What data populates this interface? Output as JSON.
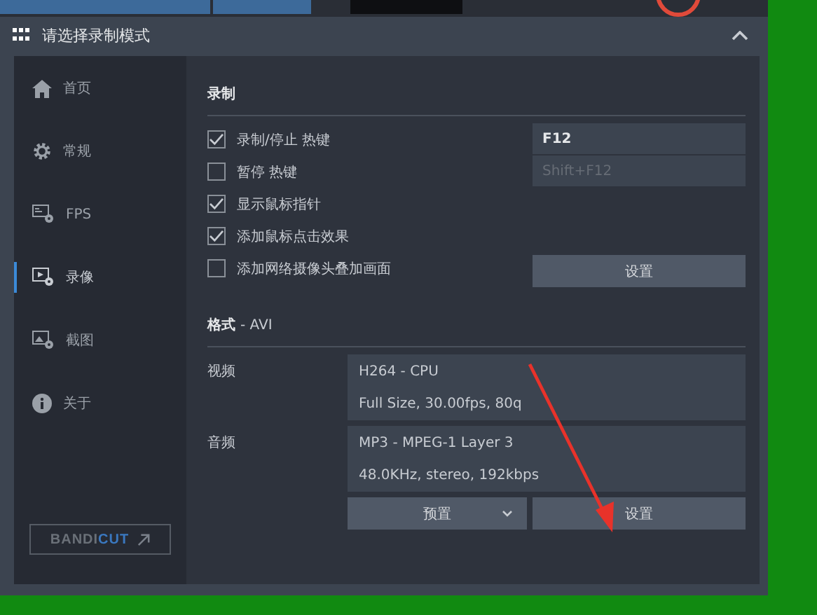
{
  "window": {
    "title": "请选择录制模式"
  },
  "sidebar": {
    "items": [
      {
        "label": "首页",
        "kind": "home",
        "selected": false
      },
      {
        "label": "常规",
        "kind": "gear",
        "selected": false
      },
      {
        "label": "FPS",
        "kind": "fps",
        "selected": false
      },
      {
        "label": "录像",
        "kind": "video",
        "selected": true
      },
      {
        "label": "截图",
        "kind": "image",
        "selected": false
      },
      {
        "label": "关于",
        "kind": "info",
        "selected": false
      }
    ],
    "logo_parts": [
      "BANDI",
      "CUT"
    ]
  },
  "record": {
    "heading": "录制",
    "options": [
      {
        "label": "录制/停止 热键",
        "checked": true
      },
      {
        "label": "暂停 热键",
        "checked": false
      },
      {
        "label": "显示鼠标指针",
        "checked": true
      },
      {
        "label": "添加鼠标点击效果",
        "checked": true
      },
      {
        "label": "添加网络摄像头叠加画面",
        "checked": false
      }
    ],
    "hotkeys": [
      {
        "value": "F12",
        "disabled": false
      },
      {
        "value": "Shift+F12",
        "disabled": true
      }
    ],
    "settings_button": "设置"
  },
  "format": {
    "heading": "格式",
    "container": "- AVI",
    "video": {
      "label": "视频",
      "lines": [
        "H264 - CPU",
        "Full Size, 30.00fps, 80q"
      ]
    },
    "audio": {
      "label": "音频",
      "lines": [
        "MP3 - MPEG-1 Layer 3",
        "48.0KHz, stereo, 192kbps"
      ]
    },
    "preset_button": "预置",
    "settings_button": "设置"
  }
}
